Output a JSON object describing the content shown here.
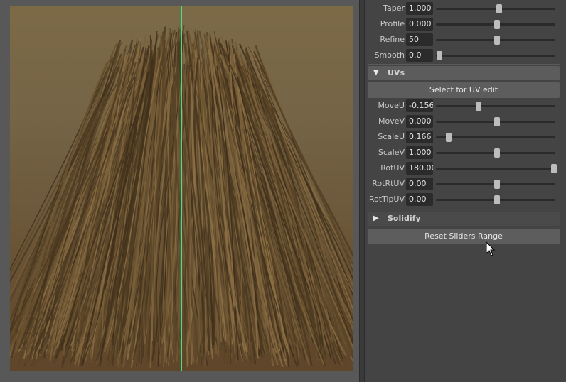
{
  "viewport": {
    "guide_line_color": "#3be38f"
  },
  "top_sliders": [
    {
      "key": "taper",
      "label": "Taper",
      "value": "1.000",
      "level": 0.53
    },
    {
      "key": "profile",
      "label": "Profile",
      "value": "0.000",
      "level": 0.51
    },
    {
      "key": "refine",
      "label": "Refine",
      "value": "50",
      "level": 0.51
    },
    {
      "key": "smooth",
      "label": "Smooth",
      "value": "0.0",
      "level": 0.03
    }
  ],
  "uvs_section": {
    "title": "UVs",
    "expanded_icon": "triangle-down-icon",
    "button_label": "Select for UV edit",
    "sliders": [
      {
        "key": "moveu",
        "label": "MoveU",
        "value": "-0.156",
        "level": 0.36
      },
      {
        "key": "movev",
        "label": "MoveV",
        "value": "0.000",
        "level": 0.51
      },
      {
        "key": "scaleu",
        "label": "ScaleU",
        "value": "0.166",
        "level": 0.11
      },
      {
        "key": "scalev",
        "label": "ScaleV",
        "value": "1.000",
        "level": 0.51
      },
      {
        "key": "rotuv",
        "label": "RotUV",
        "value": "180.00",
        "level": 0.99
      },
      {
        "key": "rotrtuv",
        "label": "RotRtUV",
        "value": "0.00",
        "level": 0.51
      },
      {
        "key": "rottipuv",
        "label": "RotTipUV",
        "value": "0.00",
        "level": 0.51
      }
    ]
  },
  "solidify_section": {
    "title": "Solidify",
    "collapsed_icon": "triangle-right-icon"
  },
  "reset_button": {
    "label": "Reset Sliders Range"
  }
}
